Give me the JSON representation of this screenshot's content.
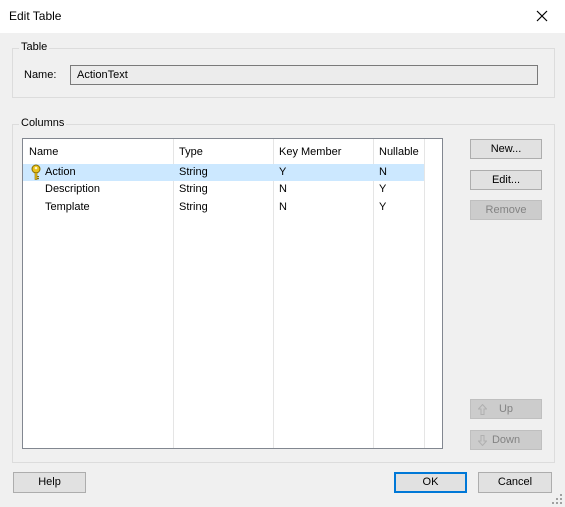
{
  "window": {
    "title": "Edit Table"
  },
  "table_group": {
    "legend": "Table",
    "name_label": "Name:",
    "name_value": "ActionText"
  },
  "columns_group": {
    "legend": "Columns",
    "headers": [
      "Name",
      "Type",
      "Key Member",
      "Nullable"
    ],
    "rows": [
      {
        "name": "Action",
        "type": "String",
        "key_member": "Y",
        "nullable": "N",
        "is_key": true,
        "selected": true
      },
      {
        "name": "Description",
        "type": "String",
        "key_member": "N",
        "nullable": "Y",
        "is_key": false,
        "selected": false
      },
      {
        "name": "Template",
        "type": "String",
        "key_member": "N",
        "nullable": "Y",
        "is_key": false,
        "selected": false
      }
    ],
    "key_icon": "key-icon"
  },
  "side_buttons": {
    "new_label": "New...",
    "edit_label": "Edit...",
    "remove_label": "Remove",
    "up_label": "Up",
    "down_label": "Down"
  },
  "footer": {
    "help_label": "Help",
    "ok_label": "OK",
    "cancel_label": "Cancel"
  },
  "colors": {
    "selection": "#cce8ff",
    "accent": "#0078d7",
    "key_icon": "#e8c21c"
  }
}
